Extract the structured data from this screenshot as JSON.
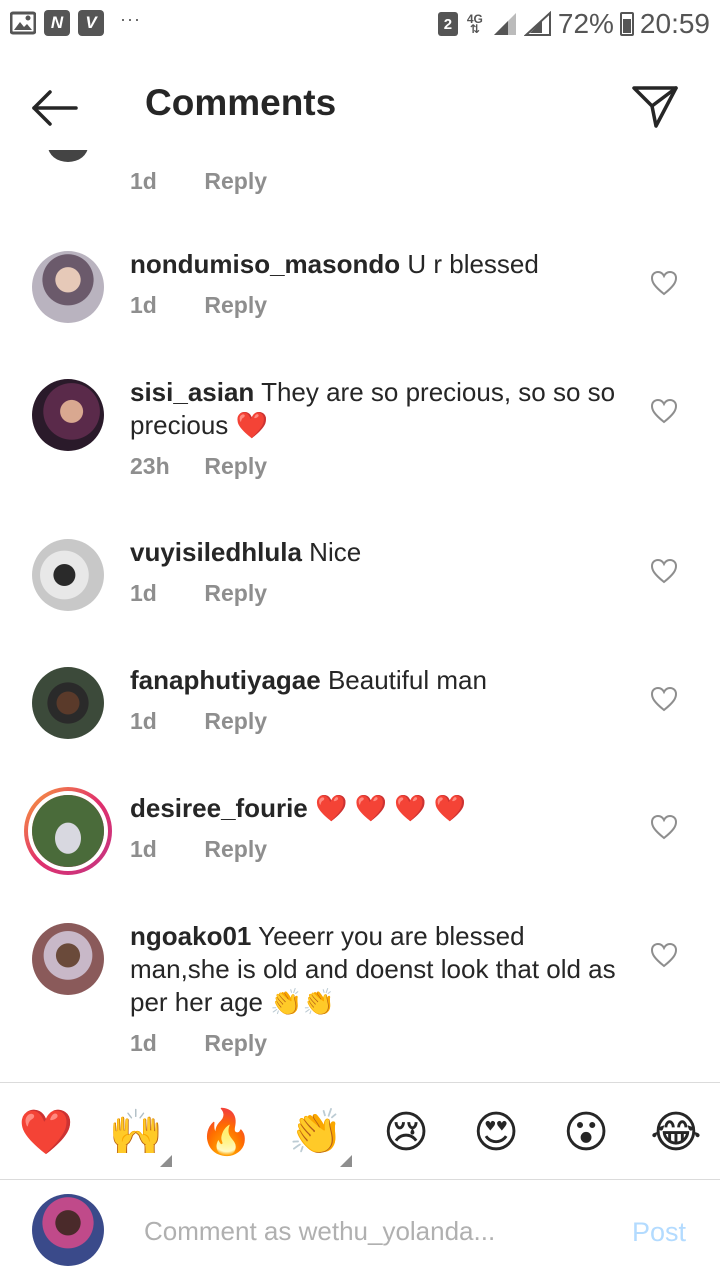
{
  "status_bar": {
    "icons_left": [
      "gallery-icon",
      "n-icon",
      "v-icon"
    ],
    "n_label": "N",
    "v_label": "V",
    "overflow": "···",
    "sim_label": "2",
    "network_label": "4G",
    "battery_pct": "72%",
    "time": "20:59"
  },
  "header": {
    "title": "Comments",
    "back_icon": "arrow-left-icon",
    "send_icon": "paper-plane-icon"
  },
  "partial_comment": {
    "time": "1d",
    "reply": "Reply"
  },
  "comments": [
    {
      "username": "nondumiso_masondo",
      "text": " U r blessed",
      "time": "1d",
      "reply": "Reply",
      "avatar_color": "#b9b3bf"
    },
    {
      "username": "sisi_asian",
      "text": " They are so precious, so so so precious ❤️",
      "time": "23h",
      "reply": "Reply",
      "avatar_color": "#5a2a4a"
    },
    {
      "username": "vuyisiledhlula",
      "text": " Nice",
      "time": "1d",
      "reply": "Reply",
      "avatar_color": "#d8d8d8"
    },
    {
      "username": "fanaphutiyagae",
      "text": " Beautiful man",
      "time": "1d",
      "reply": "Reply",
      "avatar_color": "#3c4a3a"
    },
    {
      "username": "desiree_fourie",
      "text": " ❤️ ❤️ ❤️ ❤️",
      "time": "1d",
      "reply": "Reply",
      "avatar_color": "#4a6b3a"
    },
    {
      "username": "ngoako01",
      "text": " Yeeerr you are blessed man,she is old and doenst look that old as per her age 👏👏",
      "time": "1d",
      "reply": "Reply",
      "avatar_color": "#8a5a5a"
    }
  ],
  "emoji_bar": [
    "❤️",
    "🙌",
    "🔥",
    "👏",
    "😢",
    "😍",
    "😮",
    "😂"
  ],
  "composer": {
    "placeholder": "Comment as wethu_yolanda...",
    "post_label": "Post"
  },
  "colors": {
    "text": "#262626",
    "meta": "#8e8e8e",
    "post_disabled": "#b3dbff",
    "story_ring": "#e1306c"
  }
}
